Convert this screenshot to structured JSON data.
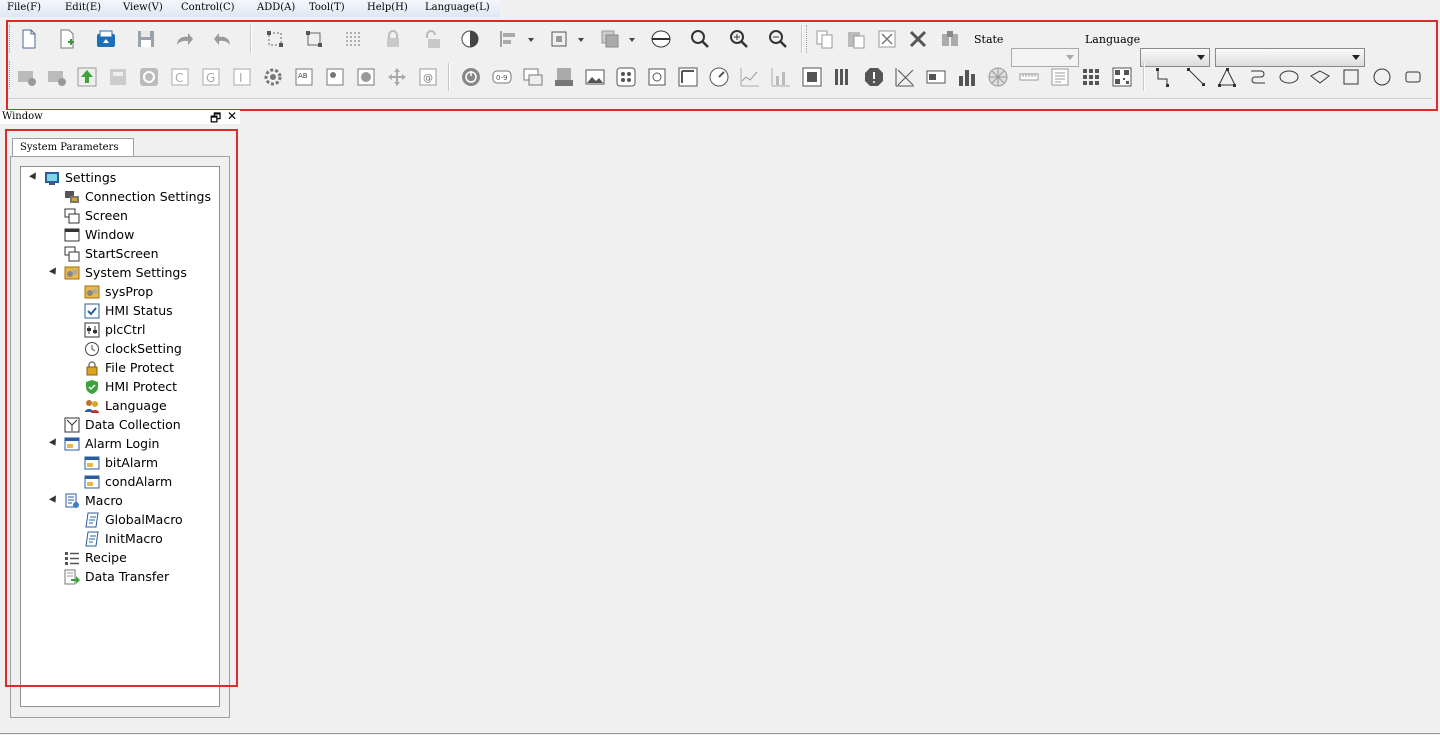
{
  "menu": [
    "File(F)",
    "Edit(E)",
    "View(V)",
    "Control(C)",
    "ADD(A)",
    "Tool(T)",
    "Help(H)",
    "Language(L)"
  ],
  "toolbar": {
    "state_label": "State",
    "state_value": "",
    "language_label": "Language",
    "language_value": "",
    "font_value": ""
  },
  "window_panel": {
    "title": "Window",
    "restore_glyph": "🗗",
    "close_glyph": "✕",
    "tab_label": "System Parameters"
  },
  "tree": [
    {
      "label": "Settings",
      "icon": "monitor-icon",
      "level": 0,
      "expanded": true
    },
    {
      "label": "Connection Settings",
      "icon": "network-icon",
      "level": 1
    },
    {
      "label": "Screen",
      "icon": "screen-icon",
      "level": 1
    },
    {
      "label": "Window",
      "icon": "window-icon",
      "level": 1
    },
    {
      "label": "StartScreen",
      "icon": "start-screen-icon",
      "level": 1
    },
    {
      "label": "System Settings",
      "icon": "gears-icon",
      "level": 1,
      "expanded": true
    },
    {
      "label": "sysProp",
      "icon": "sysprop-icon",
      "level": 2
    },
    {
      "label": "HMI Status",
      "icon": "checkbox-icon",
      "level": 2
    },
    {
      "label": "plcCtrl",
      "icon": "plc-icon",
      "level": 2
    },
    {
      "label": "clockSetting",
      "icon": "clock-icon",
      "level": 2
    },
    {
      "label": "File Protect",
      "icon": "lock-icon",
      "level": 2
    },
    {
      "label": "HMI Protect",
      "icon": "shield-icon",
      "level": 2
    },
    {
      "label": "Language",
      "icon": "people-icon",
      "level": 2
    },
    {
      "label": "Data Collection",
      "icon": "data-collection-icon",
      "level": 1
    },
    {
      "label": "Alarm Login",
      "icon": "alarm-icon",
      "level": 1,
      "expanded": true
    },
    {
      "label": "bitAlarm",
      "icon": "alarm-icon",
      "level": 2
    },
    {
      "label": "condAlarm",
      "icon": "alarm-icon",
      "level": 2
    },
    {
      "label": "Macro",
      "icon": "macro-icon",
      "level": 1,
      "expanded": true
    },
    {
      "label": "GlobalMacro",
      "icon": "script-icon",
      "level": 2
    },
    {
      "label": "InitMacro",
      "icon": "script-icon",
      "level": 2
    },
    {
      "label": "Recipe",
      "icon": "recipe-icon",
      "level": 1
    },
    {
      "label": "Data Transfer",
      "icon": "transfer-icon",
      "level": 1
    }
  ],
  "colors": {
    "highlight_box": "#e02a2a",
    "icon_blue": "#1f6fb8",
    "icon_green": "#3aa33a",
    "icon_gold": "#d9a520"
  }
}
